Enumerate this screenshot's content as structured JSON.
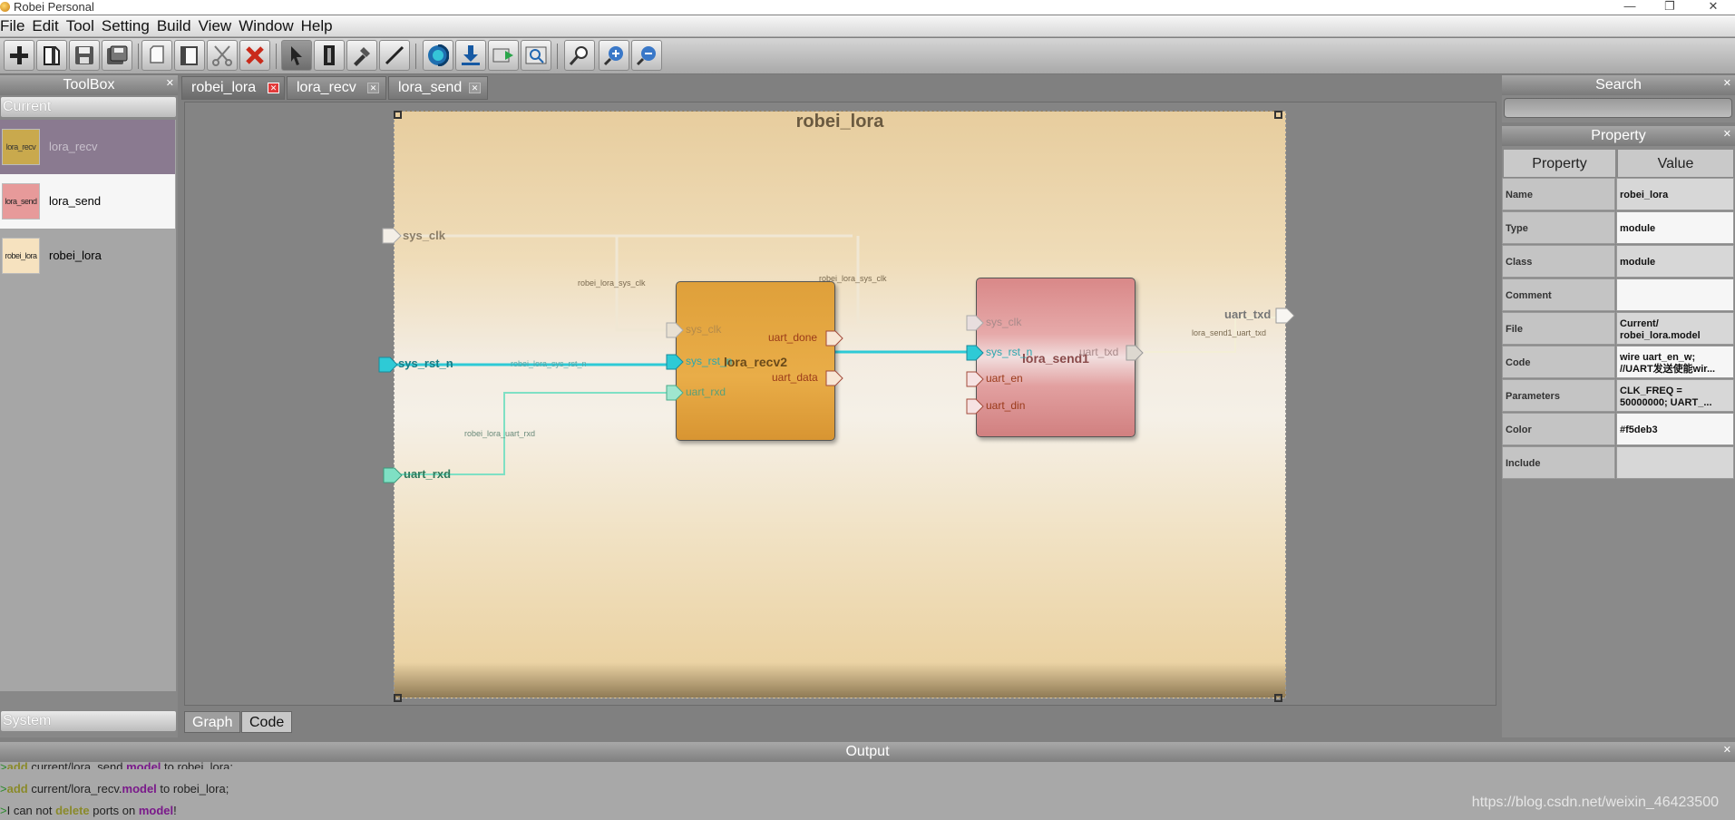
{
  "window": {
    "title": "Robei  Personal",
    "minimize": "—",
    "restore": "❐",
    "close": "✕"
  },
  "menu": [
    "File",
    "Edit",
    "Tool",
    "Setting",
    "Build",
    "View",
    "Window",
    "Help"
  ],
  "toolbox": {
    "title": "ToolBox",
    "section_current": "Current",
    "section_system": "System",
    "items": [
      {
        "label": "lora_recv",
        "thumb": "lora_recv"
      },
      {
        "label": "lora_send",
        "thumb": "lora_send"
      },
      {
        "label": "robei_lora",
        "thumb": "robei_lora"
      }
    ]
  },
  "tabs": [
    {
      "label": "robei_lora",
      "active": true
    },
    {
      "label": "lora_recv",
      "active": false
    },
    {
      "label": "lora_send",
      "active": false
    }
  ],
  "bottom_tabs": [
    "Graph",
    "Code"
  ],
  "diagram": {
    "title": "robei_lora",
    "inputs": [
      "sys_clk",
      "sys_rst_n",
      "uart_rxd"
    ],
    "outputs": [
      "uart_txd"
    ],
    "recv": {
      "name": "lora_recv2",
      "inputs": [
        "sys_clk",
        "sys_rst_n",
        "uart_rxd"
      ],
      "outputs": [
        "uart_done",
        "uart_data"
      ]
    },
    "send": {
      "name": "lora_send1",
      "inputs": [
        "sys_clk",
        "sys_rst_n",
        "uart_en",
        "uart_din"
      ],
      "outputs": [
        "uart_txd"
      ]
    },
    "wire_labels": {
      "clk1": "robei_lora_sys_clk",
      "clk2": "robei_lora_sys_clk",
      "rst": "robei_lora_sys_rst_n",
      "rxd": "robei_lora_uart_rxd",
      "txd": "lora_send1_uart_txd"
    }
  },
  "search": {
    "title": "Search",
    "value": ""
  },
  "property": {
    "title": "Property",
    "col_property": "Property",
    "col_value": "Value",
    "rows": [
      {
        "k": "Name",
        "v": "robei_lora"
      },
      {
        "k": "Type",
        "v": "module"
      },
      {
        "k": "Class",
        "v": "module"
      },
      {
        "k": "Comment",
        "v": ""
      },
      {
        "k": "File",
        "v": "Current/ robei_lora.model"
      },
      {
        "k": "Code",
        "v": "wire      uart_en_w; //UART发送使能wir..."
      },
      {
        "k": "Parameters",
        "v": "CLK_FREQ = 50000000; UART_..."
      },
      {
        "k": "Color",
        "v": "#f5deb3"
      },
      {
        "k": "Include",
        "v": ""
      }
    ]
  },
  "output": {
    "title": "Output",
    "lines": [
      {
        "prefix": ">",
        "a": "add",
        "b": " current/lora_send.",
        "c": "model",
        "d": " to ",
        "e": "robei_lora;"
      },
      {
        "prefix": ">",
        "a": "add",
        "b": " current/lora_recv.",
        "c": "model",
        "d": " to ",
        "e": "robei_lora;"
      },
      {
        "prefix": ">",
        "a": "I can not ",
        "b": "delete",
        "c": " ports on ",
        "d": "model",
        "e": "!"
      }
    ]
  },
  "watermark": "https://blog.csdn.net/weixin_46423500",
  "colors": {
    "accent_wire": "#2ecad6",
    "rx_wire": "#7fe0c4",
    "module_bg": "#f5deb3",
    "recv_block": "#e3a23a",
    "send_block": "#dd9090",
    "tab_close": "#e23b3b"
  },
  "icons": [
    "new-icon",
    "open-icon",
    "save-icon",
    "save-all-icon",
    "copy-icon",
    "paste-icon",
    "cut-icon",
    "delete-icon",
    "select-icon",
    "port-icon",
    "connect-icon",
    "wire-icon",
    "run-icon",
    "download-icon",
    "simulate-icon",
    "zoom-fit-icon",
    "search-icon",
    "zoom-in-icon",
    "zoom-out-icon"
  ]
}
